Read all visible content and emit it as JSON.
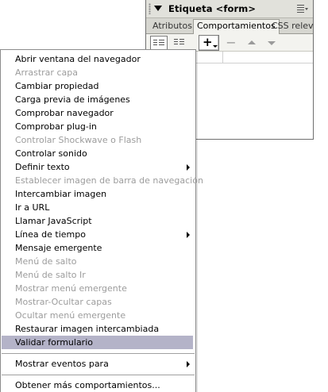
{
  "panel": {
    "title": "Etiqueta <form>",
    "tabs": [
      {
        "label": "Atributos"
      },
      {
        "label": "Comportamientos"
      },
      {
        "label": "CSS releva"
      }
    ],
    "toolbar": {
      "add_label": "+",
      "remove_label": "−"
    }
  },
  "menu": {
    "items": [
      {
        "label": "Abrir ventana del navegador",
        "enabled": true
      },
      {
        "label": "Arrastrar capa",
        "enabled": false
      },
      {
        "label": "Cambiar propiedad",
        "enabled": true
      },
      {
        "label": "Carga previa de imágenes",
        "enabled": true
      },
      {
        "label": "Comprobar navegador",
        "enabled": true
      },
      {
        "label": "Comprobar plug-in",
        "enabled": true
      },
      {
        "label": "Controlar Shockwave o Flash",
        "enabled": false
      },
      {
        "label": "Controlar sonido",
        "enabled": true
      },
      {
        "label": "Definir texto",
        "enabled": true,
        "submenu": true
      },
      {
        "label": "Establecer imagen de barra de navegación",
        "enabled": false
      },
      {
        "label": "Intercambiar imagen",
        "enabled": true
      },
      {
        "label": "Ir a URL",
        "enabled": true
      },
      {
        "label": "Llamar JavaScript",
        "enabled": true
      },
      {
        "label": "Línea de tiempo",
        "enabled": true,
        "submenu": true
      },
      {
        "label": "Mensaje emergente",
        "enabled": true
      },
      {
        "label": "Menú de salto",
        "enabled": false
      },
      {
        "label": "Menú de salto Ir",
        "enabled": false
      },
      {
        "label": "Mostrar menú emergente",
        "enabled": false
      },
      {
        "label": "Mostrar-Ocultar capas",
        "enabled": false
      },
      {
        "label": "Ocultar menú emergente",
        "enabled": false
      },
      {
        "label": "Restaurar imagen intercambiada",
        "enabled": true
      },
      {
        "label": "Validar formulario",
        "enabled": true,
        "highlighted": true
      }
    ],
    "show_events": {
      "label": "Mostrar eventos para",
      "submenu": true
    },
    "more": {
      "label": "Obtener más comportamientos..."
    }
  },
  "colors": {
    "highlight": "#b4b3c8",
    "disabled_text": "#9c9c9c",
    "panel_header": "#e1e1db"
  }
}
